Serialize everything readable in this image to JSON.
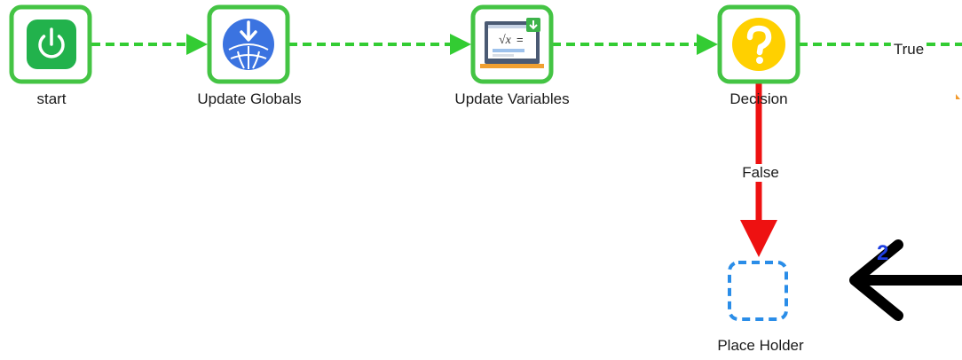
{
  "nodes": {
    "start": {
      "label": "start"
    },
    "update_globals": {
      "label": "Update Globals"
    },
    "update_variables": {
      "label": "Update Variables"
    },
    "decision": {
      "label": "Decision"
    },
    "place_holder": {
      "label": "Place Holder"
    }
  },
  "edges": {
    "true_label": "True",
    "false_label": "False"
  },
  "annotation": {
    "badge": "2"
  },
  "colors": {
    "node_border": "#44c444",
    "flow_edge": "#33cc33",
    "false_edge": "#ee1111",
    "start_icon": "#22b24c",
    "globals_icon": "#3b73e0",
    "decision_icon": "#ffd000",
    "placeholder_border": "#2a8de8",
    "badge": "#1f3fe0",
    "pointer_arrow": "#000000"
  },
  "icons": {
    "start": "power-icon",
    "update_globals": "globe-download-icon",
    "update_variables": "formula-board-icon",
    "decision": "question-icon",
    "pointer": "arrow-left-icon"
  }
}
